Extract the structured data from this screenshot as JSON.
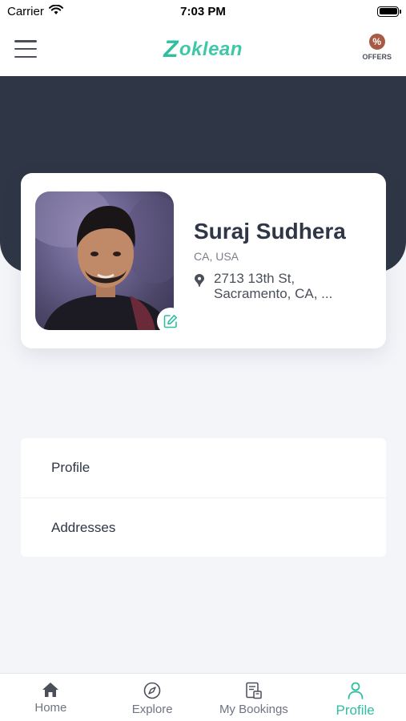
{
  "status_bar": {
    "carrier": "Carrier",
    "time": "7:03 PM"
  },
  "header": {
    "logo_z": "Z",
    "logo_rest": "oklean",
    "offers_label": "OFFERS"
  },
  "profile": {
    "name": "Suraj Sudhera",
    "region": "CA, USA",
    "address": "2713 13th St, Sacramento, CA, ..."
  },
  "menu": {
    "items": [
      {
        "label": "Profile"
      },
      {
        "label": "Addresses"
      }
    ]
  },
  "tabs": [
    {
      "label": "Home",
      "icon": "home-icon"
    },
    {
      "label": "Explore",
      "icon": "compass-icon"
    },
    {
      "label": "My Bookings",
      "icon": "bookings-icon"
    },
    {
      "label": "Profile",
      "icon": "user-icon",
      "active": true
    }
  ],
  "colors": {
    "accent": "#2fbfa0",
    "hero": "#2f3747",
    "background": "#f4f5f9",
    "offers": "#a85a45"
  }
}
